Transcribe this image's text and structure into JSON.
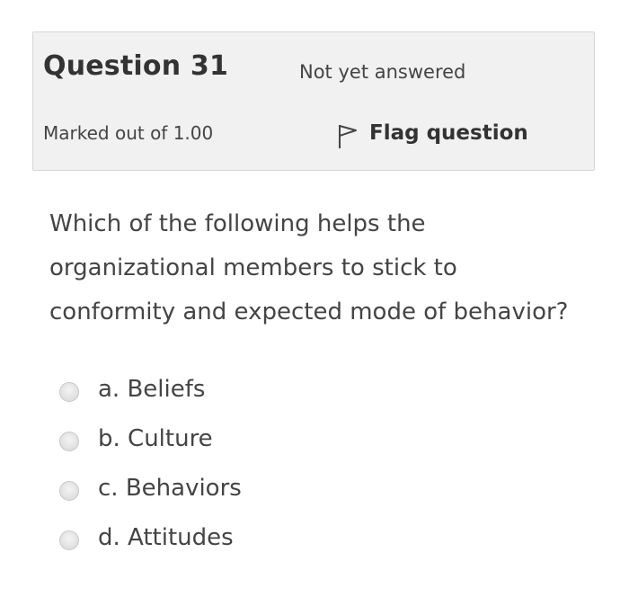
{
  "question": {
    "title_prefix": "Question",
    "number": "31",
    "status": "Not yet answered",
    "grade": "Marked out of 1.00",
    "flag_label": "Flag question",
    "flag_icon": "flag-outline-icon",
    "text": "Which of the following helps the organizational members to stick to conformity and expected mode of behavior?"
  },
  "answers": [
    {
      "label": "a. Beliefs",
      "selected": false
    },
    {
      "label": "b. Culture",
      "selected": false
    },
    {
      "label": "c. Behaviors",
      "selected": false
    },
    {
      "label": "d. Attitudes",
      "selected": false
    }
  ]
}
